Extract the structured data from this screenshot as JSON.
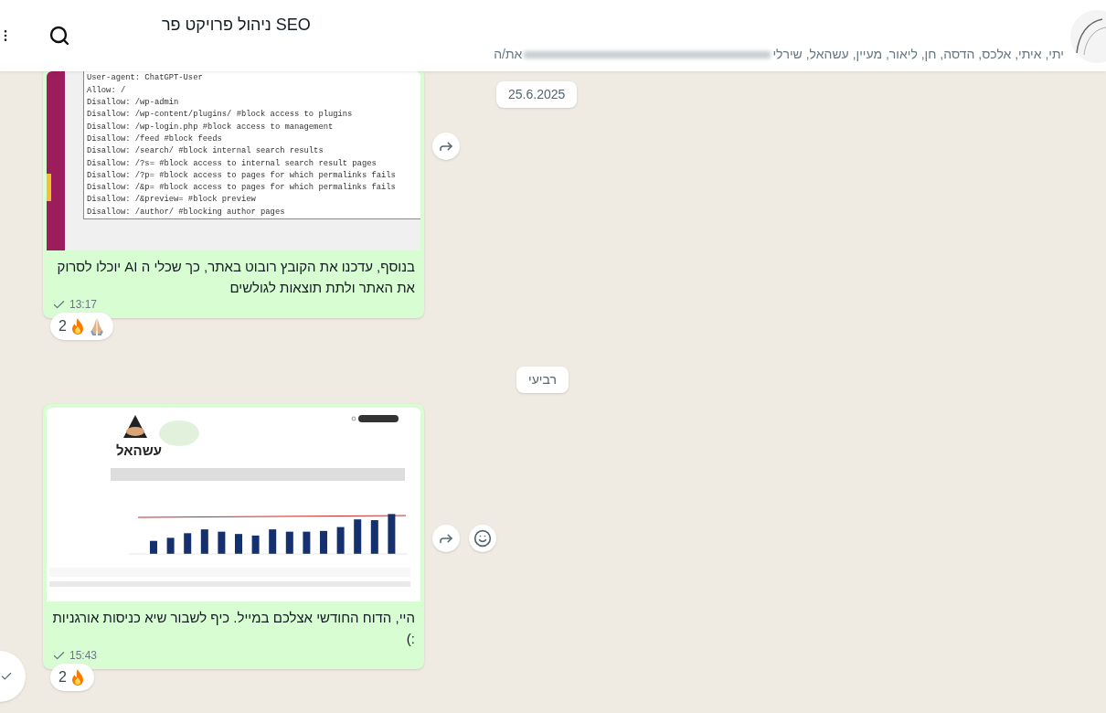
{
  "header": {
    "title": "SEO ניהול פרויקט פר",
    "members": "יתי, איתי, אלכס, הדסה, חן, ליאור, מעיין, עשהאל, שירלי",
    "self": "את/ה"
  },
  "date_chips": [
    "25.6.2025",
    "רביעי"
  ],
  "messages": [
    {
      "kind": "code_screenshot",
      "code_lines": [
        "User-agent: ChatGPT-User",
        "Allow: /",
        "Disallow: /wp-admin",
        "Disallow: /wp-content/plugins/ #block access to plugins",
        "Disallow: /wp-login.php #block access to management",
        "Disallow: /feed #block feeds",
        "Disallow: /search/ #block internal search results",
        "Disallow: /?s= #block access to internal search result pages",
        "Disallow: /?p= #block access to pages for which permalinks fails",
        "Disallow: /&p= #block access to pages for which permalinks fails",
        "Disallow: /&preview= #block preview",
        "Disallow: /author/ #blocking author pages"
      ],
      "text": "בנוסף, עדכנו את הקובץ רובוט באתר, כך שכלי ה AI יוכלו לסרוק את האתר ולתת תוצאות לגולשים",
      "time": "13:17",
      "reactions": {
        "count": "2",
        "items": [
          {
            "kind": "fire"
          },
          {
            "kind": "pray"
          }
        ]
      }
    },
    {
      "kind": "dashboard_screenshot",
      "logo_text": "עשהאל",
      "text": "היי, הדוח החודשי אצלכם במייל. כיף לשבור שיא כניסות אורגניות :)",
      "time": "15:43",
      "reactions": {
        "count": "2",
        "items": [
          {
            "kind": "fire"
          }
        ]
      }
    }
  ]
}
